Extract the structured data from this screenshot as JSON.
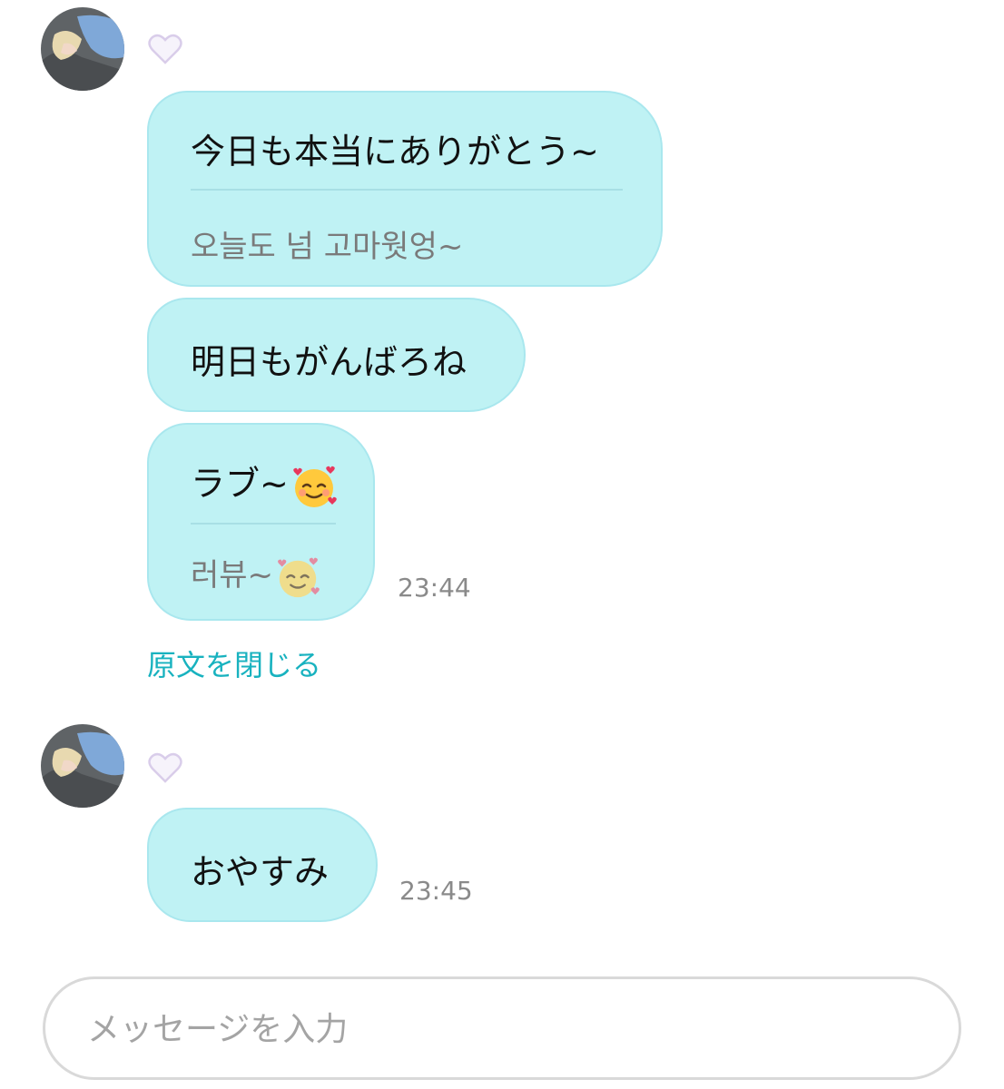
{
  "colors": {
    "bubble_bg": "#bff2f4",
    "bubble_border": "#a9e7ee",
    "link": "#18b2bf",
    "time": "#8a8a8a",
    "heart": "#d9cdea"
  },
  "groups": [
    {
      "avatar": "user-avatar-photo",
      "badge_icon": "white-heart-icon",
      "messages": [
        {
          "text": "今日も本当にありがとう~",
          "translation": "오늘도 넘 고마웟엉~"
        },
        {
          "text": "明日もがんばろね"
        },
        {
          "text": "ラブ~",
          "text_emoji": "smiling-face-with-hearts",
          "translation": "러뷰~",
          "translation_emoji": "smiling-face-with-hearts",
          "time": "23:44"
        }
      ],
      "close_original_label": "原文を閉じる"
    },
    {
      "avatar": "user-avatar-photo",
      "badge_icon": "white-heart-icon",
      "messages": [
        {
          "text": "おやすみ",
          "time": "23:45"
        }
      ]
    }
  ],
  "composer": {
    "placeholder": "メッセージを入力"
  }
}
